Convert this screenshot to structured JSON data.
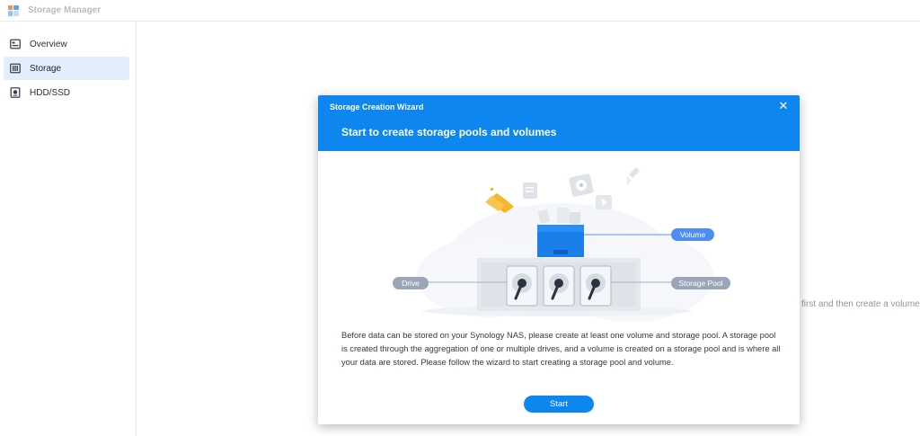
{
  "app": {
    "title": "Storage Manager"
  },
  "sidebar": {
    "items": [
      {
        "label": "Overview",
        "icon": "overview-icon",
        "active": false
      },
      {
        "label": "Storage",
        "icon": "storage-icon",
        "active": true
      },
      {
        "label": "HDD/SSD",
        "icon": "hdd-icon",
        "active": false
      }
    ]
  },
  "background": {
    "hint": "first and then create a volume."
  },
  "dialog": {
    "title": "Storage Creation Wizard",
    "heading": "Start to create storage pools and volumes",
    "labels": {
      "volume": "Volume",
      "drive": "Drive",
      "storage_pool": "Storage Pool"
    },
    "description": "Before data can be stored on your Synology NAS, please create at least one volume and storage pool. A storage pool is created through the aggregation of one or multiple drives, and a volume is created on a storage pool and is where all your data are stored. Please follow the wizard to start creating a storage pool and volume.",
    "start_label": "Start"
  },
  "colors": {
    "accent": "#0d86ef",
    "active_nav_bg": "#e3eefb",
    "label_pill": "#9aa6b8",
    "volume_pill": "#4d8ef0",
    "folder_yellow": "#f7b529"
  }
}
